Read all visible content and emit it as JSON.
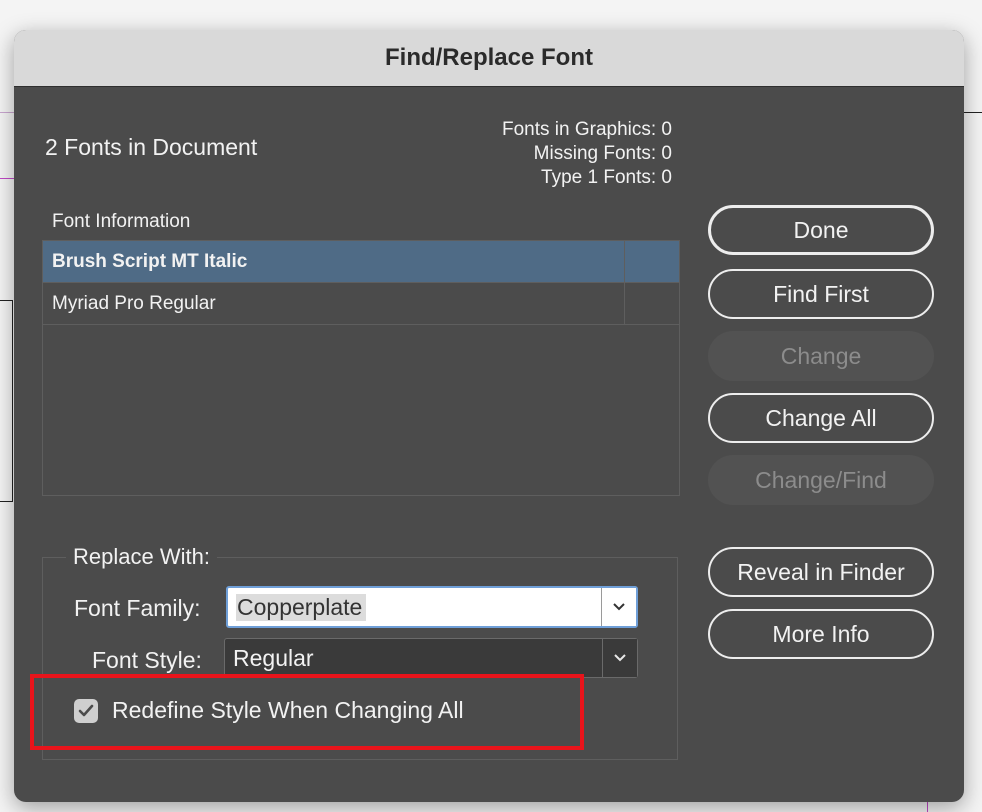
{
  "window": {
    "title": "Find/Replace Font"
  },
  "summary": {
    "fonts_in_document": "2 Fonts in Document",
    "fonts_in_graphics": "Fonts in Graphics: 0",
    "missing_fonts": "Missing Fonts: 0",
    "type1_fonts": "Type 1 Fonts: 0"
  },
  "font_list": {
    "header": "Font Information",
    "rows": [
      {
        "name": "Brush Script MT Italic",
        "selected": true
      },
      {
        "name": "Myriad Pro Regular",
        "selected": false
      }
    ]
  },
  "buttons": {
    "done": "Done",
    "find_first": "Find First",
    "change": "Change",
    "change_all": "Change All",
    "change_find": "Change/Find",
    "reveal_in_finder": "Reveal in Finder",
    "more_info": "More Info"
  },
  "replace": {
    "group_label": "Replace With:",
    "font_family_label": "Font Family:",
    "font_family_value": "Copperplate",
    "font_style_label": "Font Style:",
    "font_style_value": "Regular",
    "redefine_label": "Redefine Style When Changing All",
    "redefine_checked": true
  },
  "colors": {
    "dialog_bg": "#4b4b4b",
    "selection": "#4f6b86",
    "highlight": "#e8141b"
  }
}
